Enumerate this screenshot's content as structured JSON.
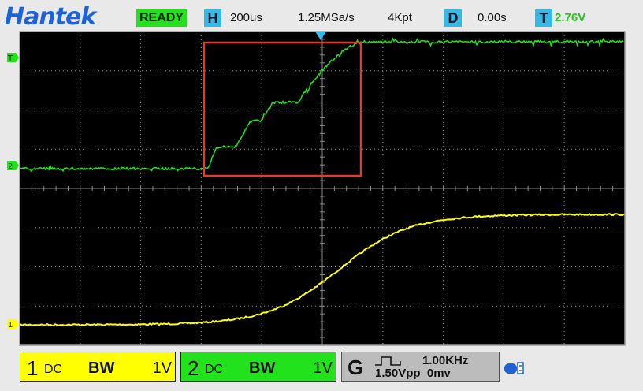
{
  "header": {
    "brand": "Hantek",
    "status": "READY",
    "h_label": "H",
    "timebase": "200us",
    "sample_rate": "1.25MSa/s",
    "memory_depth": "4Kpt",
    "d_label": "D",
    "delay": "0.00s",
    "t_label": "T",
    "trigger_level": "2.76V"
  },
  "markers": {
    "ch1": "1",
    "ch2": "2",
    "trigger": "T"
  },
  "channels": [
    {
      "number": "1",
      "coupling": "DC",
      "bw": "BW",
      "scale": "1V",
      "color": "#ffff00"
    },
    {
      "number": "2",
      "coupling": "DC",
      "bw": "BW",
      "scale": "1V",
      "color": "#22e31b"
    }
  ],
  "generator": {
    "label": "G",
    "frequency": "1.00KHz",
    "amplitude": "1.50Vpp",
    "offset": "0mv"
  },
  "colors": {
    "brand": "#1e63d6",
    "ready": "#22e31b",
    "badge": "#37b9e6",
    "ch1": "#ffff00",
    "ch2": "#22e31b",
    "zoom_box": "#e23a2e",
    "grid": "#8a8a8a",
    "screen_bg": "#000000"
  },
  "icons": {
    "trigger_position": "trigger-position-triangle-icon",
    "usb": "usb-icon",
    "square_wave": "square-wave-icon"
  }
}
